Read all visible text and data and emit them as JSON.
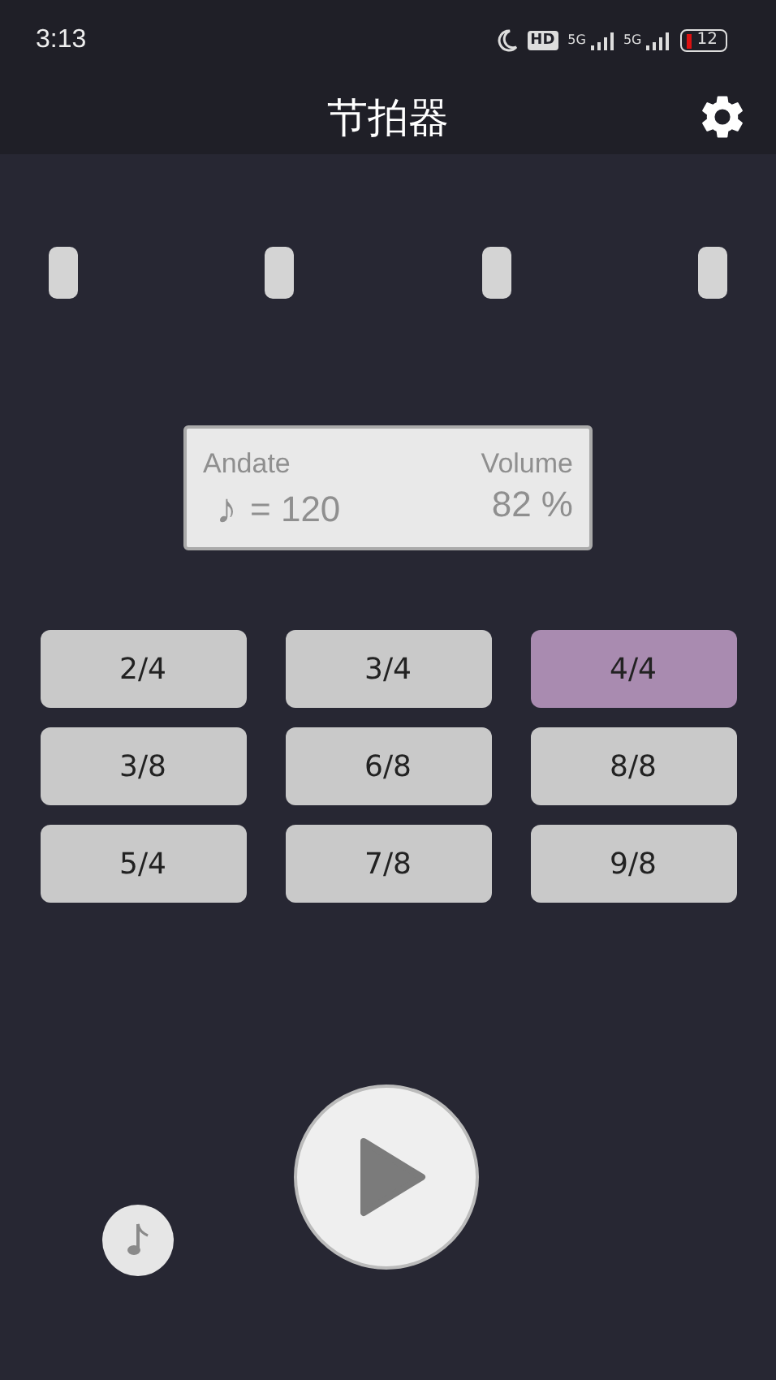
{
  "status_bar": {
    "time": "3:13",
    "hd": "HD",
    "networks": [
      "5G",
      "5G"
    ],
    "battery": "12"
  },
  "header": {
    "title": "节拍器"
  },
  "beats": [
    {
      "kind": "beat"
    },
    {
      "kind": "beat"
    },
    {
      "kind": "beat"
    },
    {
      "kind": "beat"
    }
  ],
  "display": {
    "tempo_name": "Andate",
    "note": "♪",
    "tempo": "= 120",
    "volume_label": "Volume",
    "volume": "82 %"
  },
  "time_signatures": [
    {
      "label": "2/4",
      "selected": false
    },
    {
      "label": "3/4",
      "selected": false
    },
    {
      "label": "4/4",
      "selected": true
    },
    {
      "label": "3/8",
      "selected": false
    },
    {
      "label": "6/8",
      "selected": false
    },
    {
      "label": "8/8",
      "selected": false
    },
    {
      "label": "5/4",
      "selected": false
    },
    {
      "label": "7/8",
      "selected": false
    },
    {
      "label": "9/8",
      "selected": false
    }
  ]
}
